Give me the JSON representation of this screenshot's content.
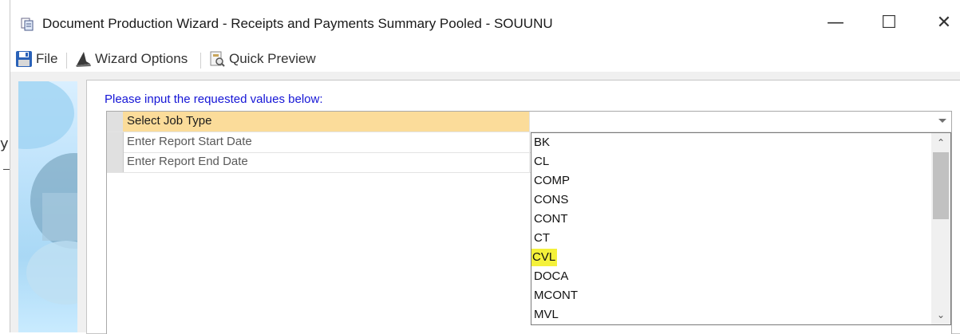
{
  "window": {
    "title": "Document Production Wizard - Receipts and Payments Summary Pooled - SOUUNU",
    "controls": {
      "minimize": "—",
      "maximize": "☐",
      "close": "✕"
    }
  },
  "toolbar": {
    "items": [
      {
        "label": "File",
        "icon": "save-disk-icon"
      },
      {
        "label": "Wizard Options",
        "icon": "wizard-hat-icon"
      },
      {
        "label": "Quick Preview",
        "icon": "preview-icon"
      }
    ]
  },
  "background": {
    "glyph": "y"
  },
  "main": {
    "prompt": "Please input the requested values below:",
    "rows": [
      {
        "label": "Select Job Type",
        "value": ""
      },
      {
        "label": "Enter Report Start Date",
        "value": ""
      },
      {
        "label": "Enter Report End Date",
        "value": ""
      }
    ]
  },
  "dropdown": {
    "options": [
      "BK",
      "CL",
      "COMP",
      "CONS",
      "CONT",
      "CT",
      "CVL",
      "DOCA",
      "MCONT",
      "MVL"
    ],
    "highlighted": "CVL",
    "scroll_up": "⌃",
    "scroll_down": "⌄"
  },
  "colors": {
    "selected_row": "#fbdc9a",
    "highlight": "#f4f13a",
    "prompt_text": "#1515d6"
  }
}
